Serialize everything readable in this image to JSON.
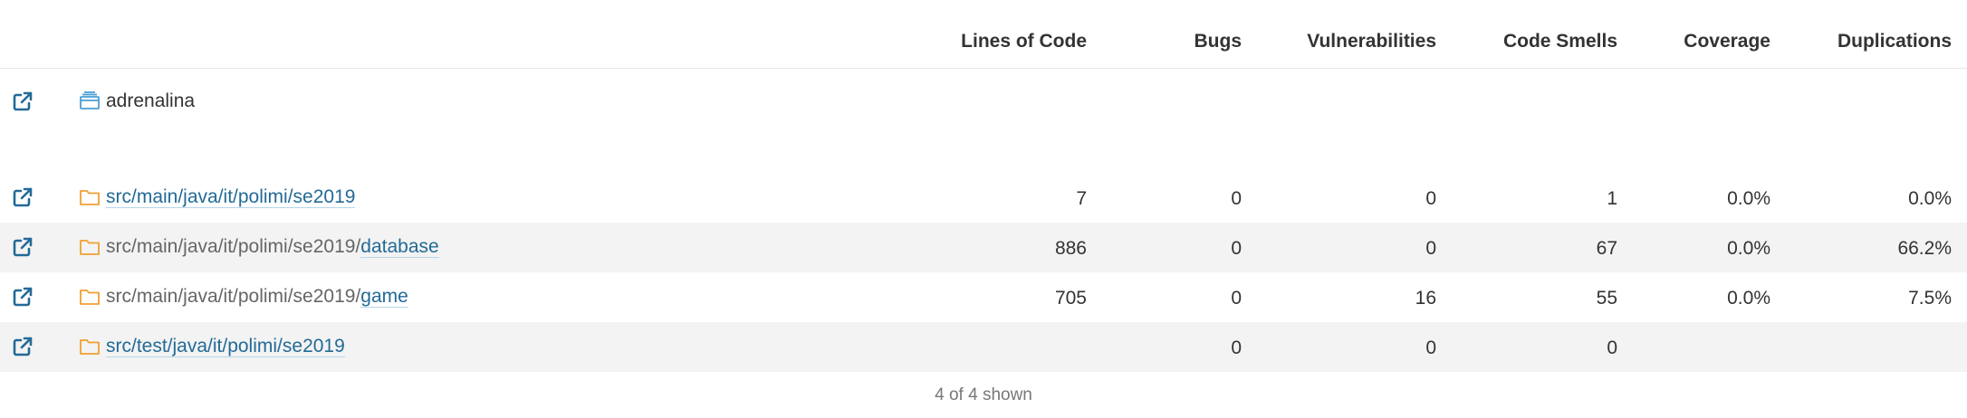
{
  "table": {
    "columns": {
      "loc": "Lines of Code",
      "bugs": "Bugs",
      "vulns": "Vulnerabilities",
      "smells": "Code Smells",
      "coverage": "Coverage",
      "dups": "Duplications"
    },
    "root": {
      "name": "adrenalina",
      "icon": "project-icon"
    },
    "rows": [
      {
        "prefix": "",
        "link": "src/main/java/it/polimi/se2019",
        "loc": "7",
        "bugs": "0",
        "vulns": "0",
        "smells": "1",
        "coverage": "0.0%",
        "dups": "0.0%"
      },
      {
        "prefix": "src/main/java/it/polimi/se2019/",
        "link": "database",
        "loc": "886",
        "bugs": "0",
        "vulns": "0",
        "smells": "67",
        "coverage": "0.0%",
        "dups": "66.2%"
      },
      {
        "prefix": "src/main/java/it/polimi/se2019/",
        "link": "game",
        "loc": "705",
        "bugs": "0",
        "vulns": "16",
        "smells": "55",
        "coverage": "0.0%",
        "dups": "7.5%"
      },
      {
        "prefix": "",
        "link": "src/test/java/it/polimi/se2019",
        "loc": "",
        "bugs": "0",
        "vulns": "0",
        "smells": "0",
        "coverage": "",
        "dups": ""
      }
    ],
    "footer": "4 of 4 shown"
  },
  "colors": {
    "link": "#236a97",
    "folder": "#f0a030",
    "project": "#4b9fd5",
    "stripe": "#f3f3f3"
  }
}
